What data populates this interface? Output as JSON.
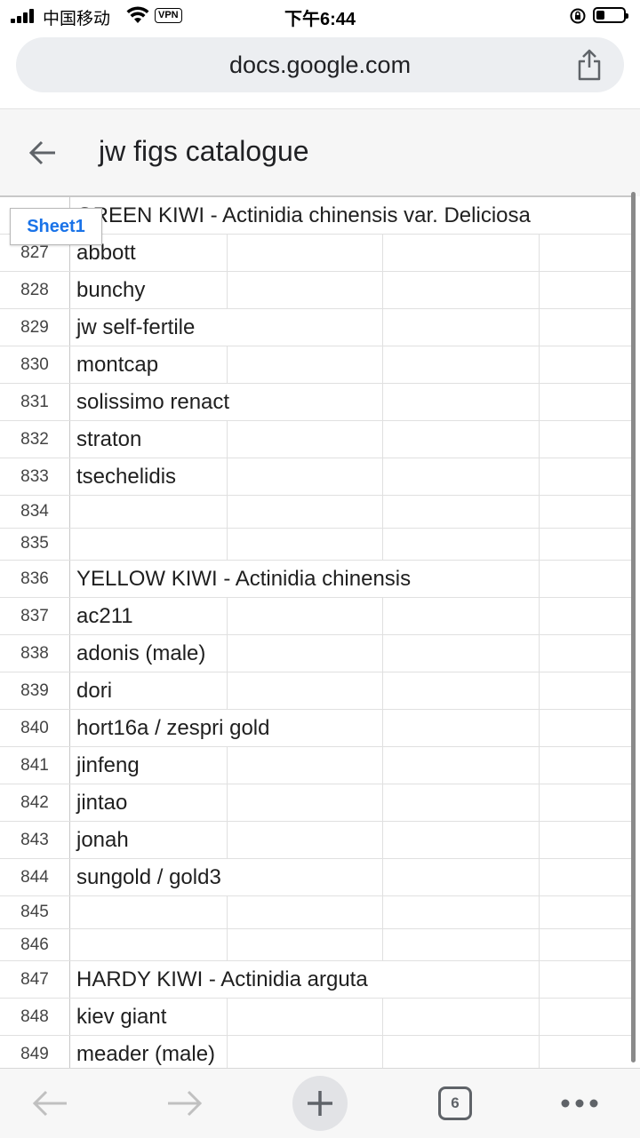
{
  "status_bar": {
    "carrier": "中国移动",
    "vpn_badge": "VPN",
    "time": "下午6:44",
    "battery_level": 0.3,
    "icons": [
      "signal-icon",
      "wifi-icon",
      "orientation-lock-icon",
      "battery-icon"
    ]
  },
  "browser": {
    "url": "docs.google.com",
    "share_icon": "share-icon"
  },
  "header": {
    "title": "jw figs catalogue",
    "back_icon": "back-arrow-icon"
  },
  "sheet": {
    "tab_label": "Sheet1",
    "rows": [
      {
        "num": "",
        "text": "GREEN KIWI - Actinidia chinensis var. Deliciosa",
        "header": true
      },
      {
        "num": "827",
        "text": "abbott"
      },
      {
        "num": "828",
        "text": "bunchy"
      },
      {
        "num": "829",
        "text": "jw self-fertile"
      },
      {
        "num": "830",
        "text": "montcap"
      },
      {
        "num": "831",
        "text": "solissimo renact"
      },
      {
        "num": "832",
        "text": "straton"
      },
      {
        "num": "833",
        "text": "tsechelidis"
      },
      {
        "num": "834",
        "text": ""
      },
      {
        "num": "835",
        "text": ""
      },
      {
        "num": "836",
        "text": "YELLOW KIWI - Actinidia chinensis",
        "header": true
      },
      {
        "num": "837",
        "text": "ac211"
      },
      {
        "num": "838",
        "text": "adonis (male)"
      },
      {
        "num": "839",
        "text": "dori"
      },
      {
        "num": "840",
        "text": "hort16a / zespri gold"
      },
      {
        "num": "841",
        "text": "jinfeng"
      },
      {
        "num": "842",
        "text": "jintao"
      },
      {
        "num": "843",
        "text": "jonah"
      },
      {
        "num": "844",
        "text": "sungold / gold3"
      },
      {
        "num": "845",
        "text": ""
      },
      {
        "num": "846",
        "text": ""
      },
      {
        "num": "847",
        "text": "HARDY KIWI - Actinidia arguta",
        "header": true
      },
      {
        "num": "848",
        "text": "kiev giant"
      },
      {
        "num": "849",
        "text": "meader (male)"
      }
    ]
  },
  "toolbar": {
    "back_icon": "back-icon",
    "forward_icon": "forward-icon",
    "new_tab_icon": "plus-icon",
    "tab_count": "6",
    "menu_icon": "more-icon"
  }
}
